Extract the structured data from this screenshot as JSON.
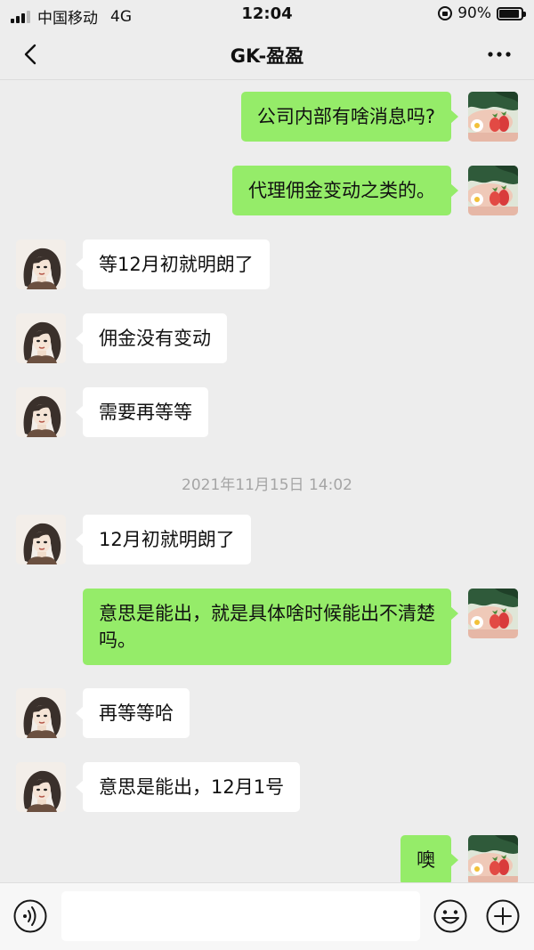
{
  "status_bar": {
    "carrier": "中国移动",
    "network": "4G",
    "time": "12:04",
    "battery": "90%",
    "battery_level": 0.9
  },
  "header": {
    "title": "GK-盈盈",
    "back_icon": "chevron-left-icon",
    "more_icon": "ellipsis-icon"
  },
  "messages": [
    {
      "dir": "out",
      "text": "公司内部有啥消息吗?"
    },
    {
      "dir": "out",
      "text": "代理佣金变动之类的。"
    },
    {
      "dir": "in",
      "text": "等12月初就明朗了"
    },
    {
      "dir": "in",
      "text": "佣金没有变动"
    },
    {
      "dir": "in",
      "text": "需要再等等"
    },
    {
      "dir": "in",
      "text": "12月初就明朗了"
    },
    {
      "dir": "out",
      "text": "意思是能出，就是具体啥时候能出不清楚吗。"
    },
    {
      "dir": "in",
      "text": "再等等哈"
    },
    {
      "dir": "in",
      "text": "意思是能出，12月1号"
    },
    {
      "dir": "out",
      "text": "噢"
    }
  ],
  "timestamp": "2021年11月15日 14:02",
  "input_bar": {
    "voice_icon": "voice-icon",
    "input_value": "",
    "emoji_icon": "emoji-icon",
    "plus_icon": "plus-icon"
  },
  "colors": {
    "background": "#ededed",
    "outgoing_bubble": "#95ec69",
    "incoming_bubble": "#ffffff",
    "timestamp_text": "#a5a5a5"
  }
}
